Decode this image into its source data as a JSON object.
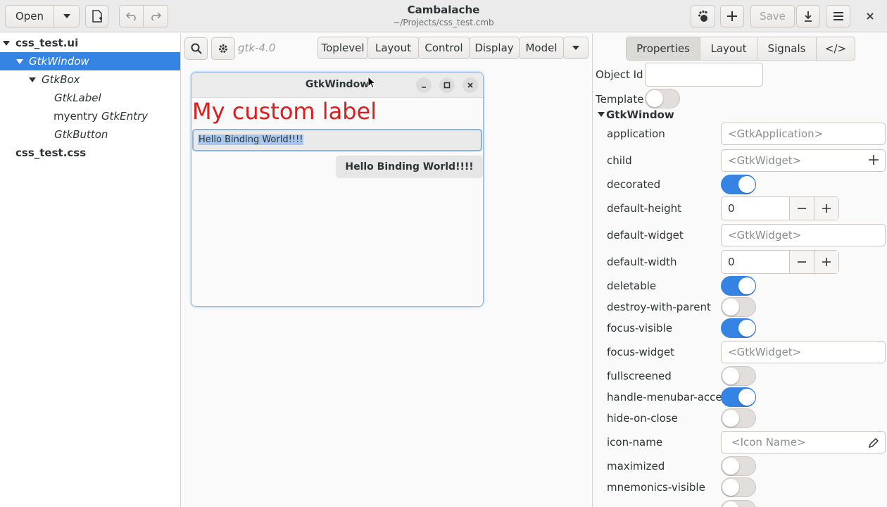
{
  "header": {
    "open_label": "Open",
    "title": "Cambalache",
    "subtitle": "~/Projects/css_test.cmb",
    "save_label": "Save"
  },
  "tree": {
    "items": [
      {
        "label": "css_test.ui"
      },
      {
        "label": "GtkWindow"
      },
      {
        "label": "GtkBox"
      },
      {
        "label": "GtkLabel"
      },
      {
        "label": "myentry",
        "type": "GtkEntry"
      },
      {
        "label": "GtkButton"
      },
      {
        "label": "css_test.css"
      }
    ]
  },
  "workspace": {
    "gtk_version": "gtk-4.0",
    "tabs": [
      "Toplevel",
      "Layout",
      "Control",
      "Display",
      "Model"
    ]
  },
  "preview": {
    "window_title": "GtkWindow",
    "label_text": "My custom label",
    "entry_text": "Hello Binding World!!!!",
    "button_text": "Hello Binding World!!!!",
    "label_color": "#e01b1b"
  },
  "properties": {
    "tabs": [
      "Properties",
      "Layout",
      "Signals",
      "</>"
    ],
    "object_id_label": "Object Id",
    "object_id_value": "",
    "template_label": "Template",
    "section": "GtkWindow",
    "rows": [
      {
        "name": "application",
        "placeholder": "<GtkApplication>"
      },
      {
        "name": "child",
        "placeholder": "<GtkWidget>"
      },
      {
        "name": "decorated",
        "on": true
      },
      {
        "name": "default-height",
        "value": "0"
      },
      {
        "name": "default-widget",
        "placeholder": "<GtkWidget>"
      },
      {
        "name": "default-width",
        "value": "0"
      },
      {
        "name": "deletable",
        "on": true
      },
      {
        "name": "destroy-with-parent",
        "on": false
      },
      {
        "name": "focus-visible",
        "on": true
      },
      {
        "name": "focus-widget",
        "placeholder": "<GtkWidget>"
      },
      {
        "name": "fullscreened",
        "on": false
      },
      {
        "name": "handle-menubar-accel",
        "on": true
      },
      {
        "name": "hide-on-close",
        "on": false
      },
      {
        "name": "icon-name",
        "placeholder": "<Icon Name>"
      },
      {
        "name": "maximized",
        "on": false
      },
      {
        "name": "mnemonics-visible",
        "on": false
      }
    ]
  },
  "colors": {
    "accent": "#3584e4",
    "headerbar": "#ebebeb"
  }
}
